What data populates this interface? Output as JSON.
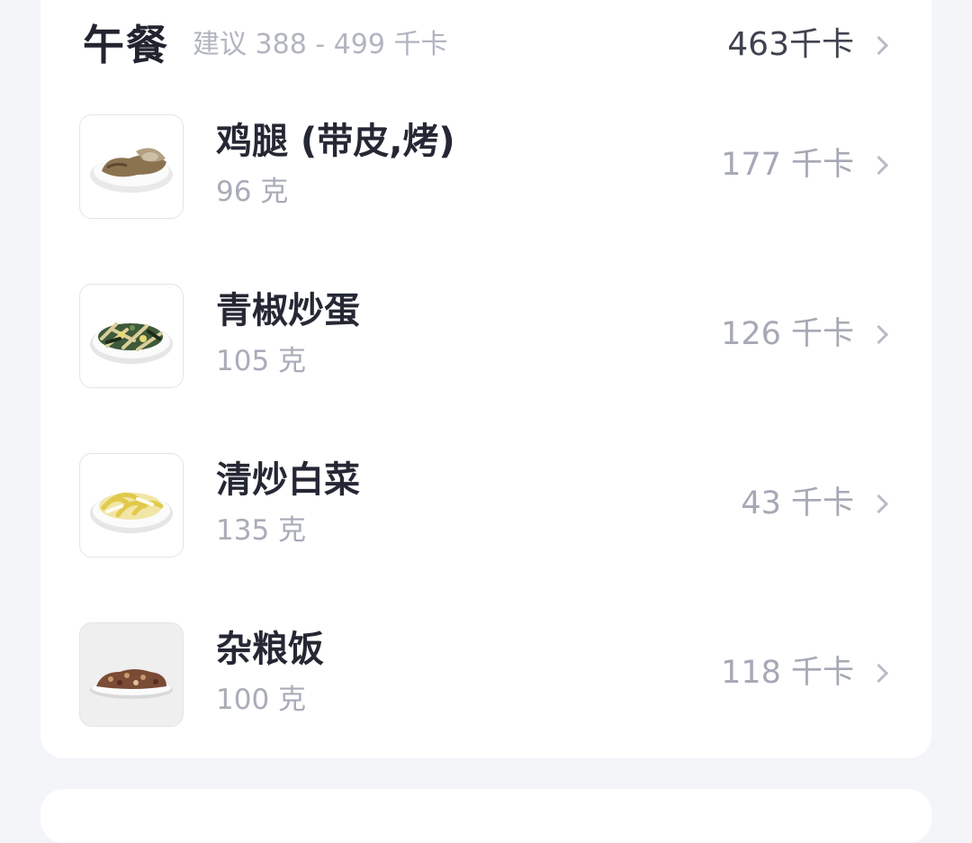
{
  "meal": {
    "title": "午餐",
    "suggestion": "建议 388 - 499 千卡",
    "total": "463千卡",
    "chevron_icon": "chevron-right-icon"
  },
  "items": [
    {
      "name": "鸡腿 (带皮,烤)",
      "weight": "96 克",
      "calories": "177 千卡",
      "icon": "roast-chicken-leg-plate"
    },
    {
      "name": "青椒炒蛋",
      "weight": "105 克",
      "calories": "126 千卡",
      "icon": "pepper-egg-plate"
    },
    {
      "name": "清炒白菜",
      "weight": "135 克",
      "calories": "43 千卡",
      "icon": "cabbage-plate"
    },
    {
      "name": "杂粮饭",
      "weight": "100 克",
      "calories": "118 千卡",
      "icon": "mixed-grain-rice-plate"
    }
  ],
  "colors": {
    "background": "#f4f5f9",
    "card": "#ffffff",
    "title": "#22252f",
    "secondary": "#a9acb8"
  }
}
